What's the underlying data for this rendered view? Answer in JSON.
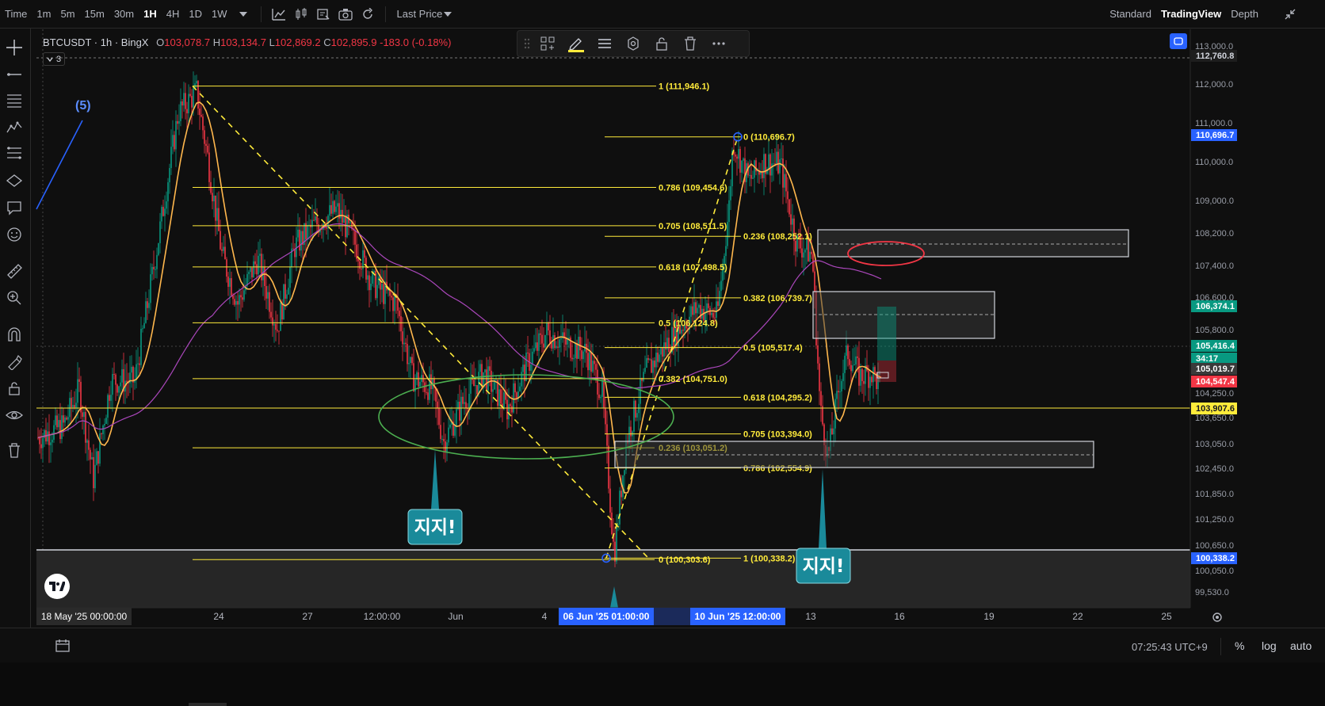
{
  "toolbar": {
    "time_label": "Time",
    "intervals": [
      "1m",
      "5m",
      "15m",
      "30m",
      "1H",
      "4H",
      "1D",
      "1W"
    ],
    "active_interval": "1H",
    "price_type": "Last Price",
    "views": [
      "Standard",
      "TradingView",
      "Depth"
    ],
    "active_view": "TradingView"
  },
  "legend": {
    "symbol": "BTCUSDT",
    "interval": "1h",
    "exchange": "BingX",
    "open_label": "O",
    "open": "103,078.7",
    "high_label": "H",
    "high": "103,134.7",
    "low_label": "L",
    "low": "102,869.2",
    "close_label": "C",
    "close": "102,895.9",
    "change": "-183.0 (-0.18%)",
    "collapsed_count": "3"
  },
  "colors": {
    "background": "#0f0f0f",
    "fib": "#ffeb3b",
    "ma_fast": "#ffb74d",
    "ma_mid": "#4caf50",
    "ma_slow": "#ab47bc",
    "up": "#089981",
    "down": "#f23645",
    "accent": "#2962ff"
  },
  "chart_data": {
    "type": "candlestick",
    "symbol": "BTCUSDT",
    "interval": "1h",
    "price_axis": {
      "ticks": [
        "113,000.0",
        "112,000.0",
        "111,000.0",
        "110,000.0",
        "109,000.0",
        "108,200.0",
        "107,400.0",
        "106,600.0",
        "105,800.0",
        "104,250.0",
        "103,650.0",
        "103,050.0",
        "102,450.0",
        "101,850.0",
        "101,250.0",
        "100,650.0",
        "100,050.0",
        "99,530.0"
      ],
      "range": [
        99250,
        113250
      ]
    },
    "price_labels": [
      {
        "value": "112,760.8",
        "style": "dark"
      },
      {
        "value": "110,696.7",
        "style": "blue"
      },
      {
        "value": "106,374.1",
        "style": "green"
      },
      {
        "value": "105,416.4",
        "style": "green"
      },
      {
        "value": "34:17",
        "style": "green"
      },
      {
        "value": "105,019.7",
        "style": "gray"
      },
      {
        "value": "104,547.4",
        "style": "red"
      },
      {
        "value": "103,907.6",
        "style": "yellow"
      },
      {
        "value": "100,338.2",
        "style": "blue"
      }
    ],
    "time_axis": {
      "ticks": [
        "24",
        "27",
        "12:00:00",
        "Jun",
        "4",
        "13",
        "16",
        "19",
        "22",
        "25"
      ],
      "highlighted": [
        "18 May '25   00:00:00",
        "06 Jun '25   01:00:00",
        "10 Jun '25   12:00:00"
      ]
    },
    "fib_retracements": [
      {
        "name": "fib-1",
        "levels": [
          {
            "label": "1 (111,946.1)",
            "price": 111946.1
          },
          {
            "label": "0.786 (109,454.6)",
            "price": 109454.6
          },
          {
            "label": "0.705 (108,511.5)",
            "price": 108511.5
          },
          {
            "label": "0.618 (107,498.5)",
            "price": 107498.5
          },
          {
            "label": "0.5 (106,124.8)",
            "price": 106124.8
          },
          {
            "label": "0.382 (104,751.0)",
            "price": 104751.0
          },
          {
            "label": "0.236 (103,051.2)",
            "price": 103051.2
          },
          {
            "label": "0 (100,303.6)",
            "price": 100303.6
          }
        ]
      },
      {
        "name": "fib-2",
        "levels": [
          {
            "label": "0 (110,696.7)",
            "price": 110696.7
          },
          {
            "label": "0.236 (108,252.1)",
            "price": 108252.1
          },
          {
            "label": "0.382 (106,739.7)",
            "price": 106739.7
          },
          {
            "label": "0.5 (105,517.4)",
            "price": 105517.4
          },
          {
            "label": "0.618 (104,295.2)",
            "price": 104295.2
          },
          {
            "label": "0.705 (103,394.0)",
            "price": 103394.0
          },
          {
            "label": "0.786 (102,554.9)",
            "price": 102554.9
          },
          {
            "label": "1 (100,338.2)",
            "price": 100338.2
          }
        ]
      }
    ],
    "annotations": [
      {
        "text": "지지!",
        "kind": "support-callout-1"
      },
      {
        "text": "지지!",
        "kind": "support-callout-2"
      },
      {
        "text": "(5)",
        "kind": "wave-label"
      }
    ],
    "moving_averages": [
      "fast",
      "mid",
      "slow"
    ]
  },
  "bottombar": {
    "clock": "07:25:43 UTC+9",
    "percent": "%",
    "log": "log",
    "auto": "auto"
  }
}
